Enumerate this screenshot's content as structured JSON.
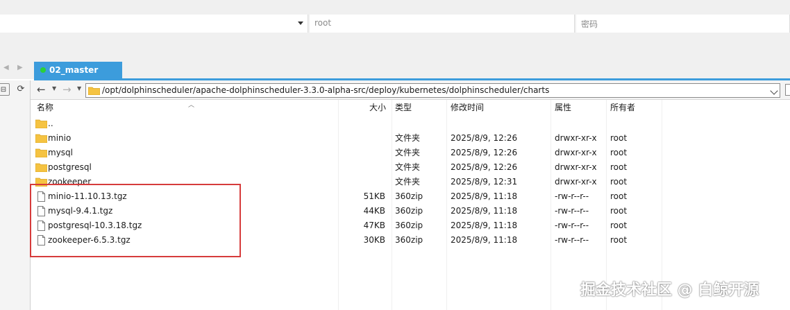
{
  "connection": {
    "username": "root",
    "password_placeholder": "密码"
  },
  "tabs": [
    {
      "label": "02_master",
      "status_color": "#2ad03a",
      "accent": "#3c9cdc"
    }
  ],
  "path": {
    "value": "/opt/dolphinscheduler/apache-dolphinscheduler-3.3.0-alpha-src/deploy/kubernetes/dolphinscheduler/charts"
  },
  "columns": {
    "name": "名称",
    "size": "大小",
    "type": "类型",
    "mtime": "修改时间",
    "attr": "属性",
    "owner": "所有者"
  },
  "rows": [
    {
      "icon": "folder-icon",
      "name": "..",
      "size": "",
      "type": "",
      "mtime": "",
      "attr": "",
      "owner": ""
    },
    {
      "icon": "folder-icon",
      "name": "minio",
      "size": "",
      "type": "文件夹",
      "mtime": "2025/8/9, 12:26",
      "attr": "drwxr-xr-x",
      "owner": "root"
    },
    {
      "icon": "folder-icon",
      "name": "mysql",
      "size": "",
      "type": "文件夹",
      "mtime": "2025/8/9, 12:26",
      "attr": "drwxr-xr-x",
      "owner": "root"
    },
    {
      "icon": "folder-icon",
      "name": "postgresql",
      "size": "",
      "type": "文件夹",
      "mtime": "2025/8/9, 12:26",
      "attr": "drwxr-xr-x",
      "owner": "root"
    },
    {
      "icon": "folder-icon",
      "name": "zookeeper",
      "size": "",
      "type": "文件夹",
      "mtime": "2025/8/9, 12:31",
      "attr": "drwxr-xr-x",
      "owner": "root"
    },
    {
      "icon": "file-icon",
      "name": "minio-11.10.13.tgz",
      "size": "51KB",
      "type": "360zip",
      "mtime": "2025/8/9, 11:18",
      "attr": "-rw-r--r--",
      "owner": "root"
    },
    {
      "icon": "file-icon",
      "name": "mysql-9.4.1.tgz",
      "size": "44KB",
      "type": "360zip",
      "mtime": "2025/8/9, 11:18",
      "attr": "-rw-r--r--",
      "owner": "root"
    },
    {
      "icon": "file-icon",
      "name": "postgresql-10.3.18.tgz",
      "size": "47KB",
      "type": "360zip",
      "mtime": "2025/8/9, 11:18",
      "attr": "-rw-r--r--",
      "owner": "root"
    },
    {
      "icon": "file-icon",
      "name": "zookeeper-6.5.3.tgz",
      "size": "30KB",
      "type": "360zip",
      "mtime": "2025/8/9, 11:18",
      "attr": "-rw-r--r--",
      "owner": "root"
    }
  ],
  "colors": {
    "folder": "#f5c342",
    "highlight": "#d63b3b"
  },
  "watermark": {
    "text": "掘金技术社区 @ 白鲸开源"
  }
}
